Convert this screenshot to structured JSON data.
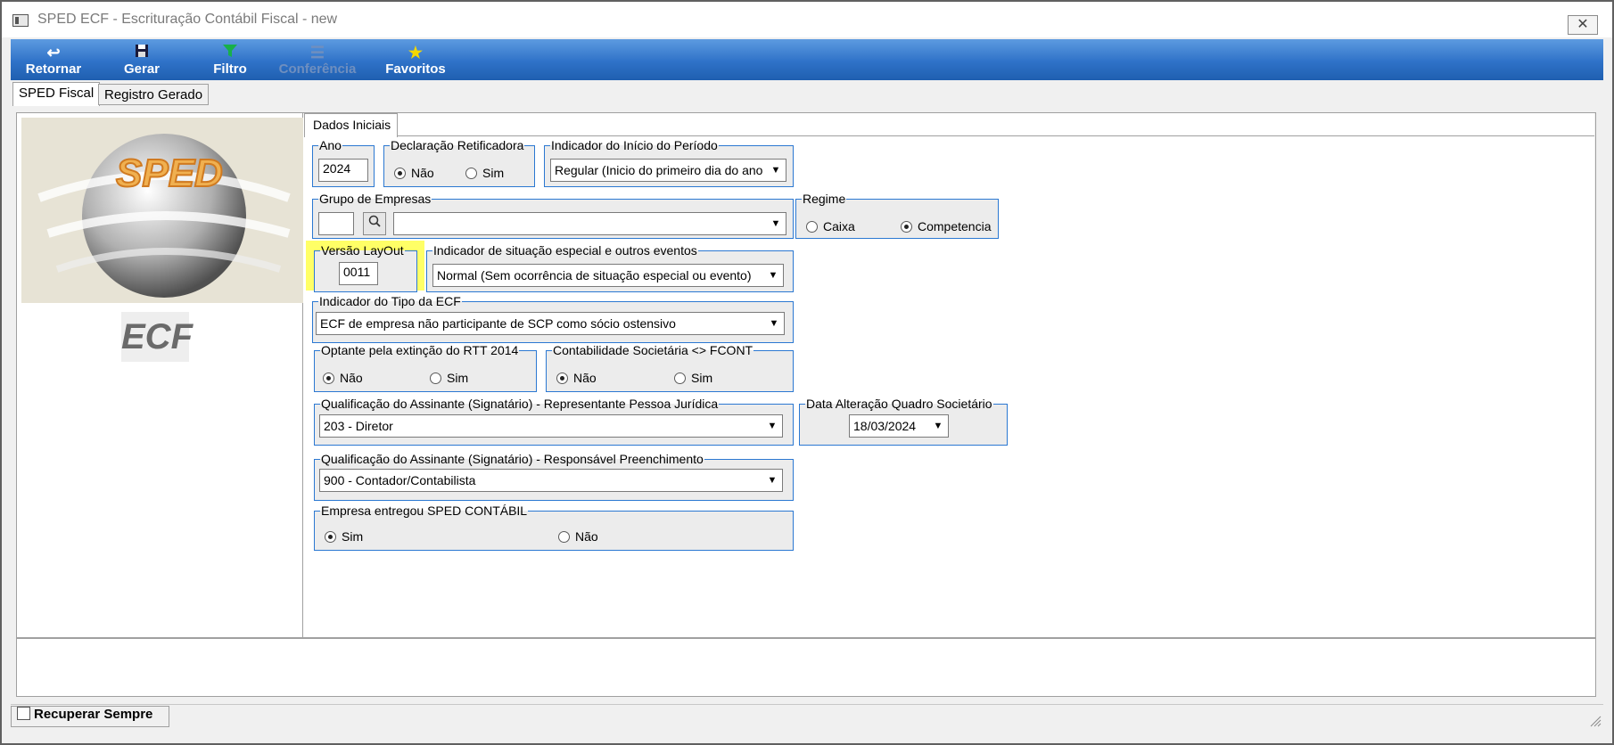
{
  "window": {
    "title": "SPED ECF - Escrituração Contábil Fiscal - new",
    "close_glyph": "✕"
  },
  "toolbar": {
    "buttons": [
      {
        "label": "Retornar",
        "icon": "undo-icon"
      },
      {
        "label": "Gerar",
        "icon": "save-icon"
      },
      {
        "label": "Filtro",
        "icon": "filter-icon"
      },
      {
        "label": "Conferência",
        "icon": "list-icon",
        "disabled": true
      },
      {
        "label": "Favoritos",
        "icon": "star-icon"
      }
    ]
  },
  "tabs": {
    "sped_fiscal": "SPED Fiscal",
    "registro_gerado": "Registro Gerado"
  },
  "logo": {
    "text": "SPED",
    "caption": "ECF"
  },
  "inner_tab": "Dados Iniciais",
  "form": {
    "ano": {
      "label": "Ano",
      "value": "2024"
    },
    "retificadora": {
      "label": "Declaração Retificadora",
      "opt_nao": "Não",
      "opt_sim": "Sim",
      "selected": "Não"
    },
    "inicio_periodo": {
      "label": "Indicador do Início do Período",
      "value": "Regular (Inicio do primeiro dia do ano"
    },
    "grupo_empresas": {
      "label": "Grupo de Empresas",
      "code": "",
      "value": ""
    },
    "regime": {
      "label": "Regime",
      "opt_caixa": "Caixa",
      "opt_competencia": "Competencia",
      "selected": "Competencia"
    },
    "versao_layout": {
      "label": "Versão LayOut",
      "value": "0011"
    },
    "situacao_especial": {
      "label": "Indicador de situação especial e outros eventos",
      "value": "Normal (Sem ocorrência de situação especial ou evento)"
    },
    "tipo_ecf": {
      "label": "Indicador do Tipo da ECF",
      "value": "ECF de empresa não participante de SCP como sócio ostensivo"
    },
    "rtt": {
      "label": "Optante pela extinção do RTT 2014",
      "opt_nao": "Não",
      "opt_sim": "Sim",
      "selected": "Não"
    },
    "fcont": {
      "label": "Contabilidade Societária <> FCONT",
      "opt_nao": "Não",
      "opt_sim": "Sim",
      "selected": "Não"
    },
    "assinante_pj": {
      "label": "Qualificação do Assinante (Signatário) - Representante Pessoa Jurídica",
      "value": "203 - Diretor"
    },
    "data_alteracao": {
      "label": "Data Alteração Quadro Societário",
      "value": "18/03/2024"
    },
    "assinante_resp": {
      "label": "Qualificação do Assinante (Signatário) - Responsável Preenchimento",
      "value": "900 - Contador/Contabilista"
    },
    "sped_contabil": {
      "label": "Empresa entregou SPED CONTÁBIL",
      "opt_sim": "Sim",
      "opt_nao": "Não",
      "selected": "Sim"
    }
  },
  "status": {
    "recuperar": "Recuperar Sempre"
  },
  "colors": {
    "group_border": "#2b78d2",
    "toolbar": "#2f72c8",
    "highlight": "#ffff66"
  }
}
